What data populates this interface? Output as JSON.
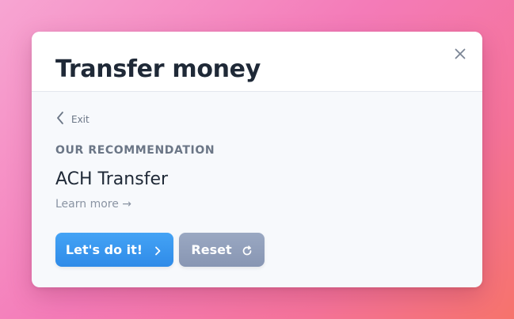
{
  "modal": {
    "title": "Transfer money",
    "close_icon": "close-icon"
  },
  "exit": {
    "label": "Exit",
    "icon": "chevron-left-icon"
  },
  "recommendation": {
    "eyebrow": "OUR RECOMMENDATION",
    "title": "ACH Transfer",
    "learn_more": "Learn more →"
  },
  "actions": {
    "primary_label": "Let's do it!",
    "primary_icon": "chevron-right-icon",
    "secondary_label": "Reset",
    "secondary_icon": "refresh-icon"
  },
  "colors": {
    "primary": "#3a97ef",
    "secondary": "#909eba",
    "title": "#1f2937",
    "muted": "#6b7686"
  }
}
